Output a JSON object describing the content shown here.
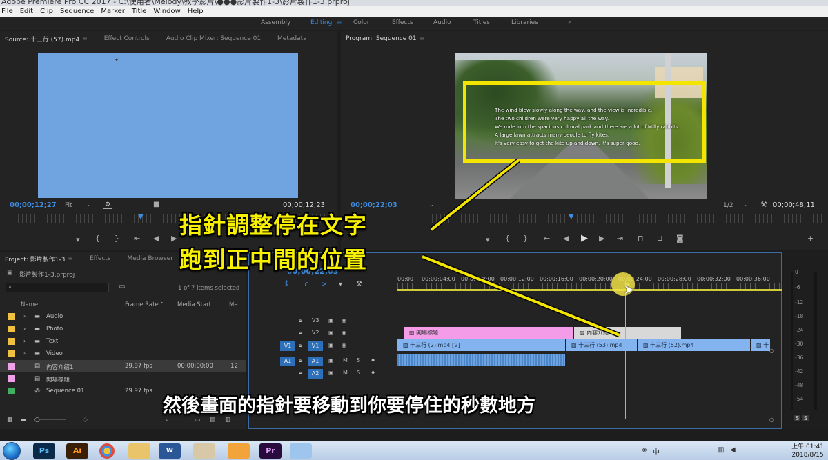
{
  "window": {
    "title": "Adobe Premiere Pro CC 2017 - C:\\使用者\\Melody\\教學影片\\●●●影片製作1-3\\影片製作1-3.prproj"
  },
  "menu": [
    "File",
    "Edit",
    "Clip",
    "Sequence",
    "Marker",
    "Title",
    "Window",
    "Help"
  ],
  "workspaces": {
    "items": [
      "Assembly",
      "Editing",
      "Color",
      "Effects",
      "Audio",
      "Titles",
      "Libraries"
    ],
    "active": "Editing",
    "more": "»"
  },
  "source_panel": {
    "tabs": [
      "Source: 十三行 (57).mp4",
      "Effect Controls",
      "Audio Clip Mixer: Sequence 01",
      "Metadata"
    ],
    "timecode": "00;00;12;27",
    "zoom": "Fit",
    "duration": "00;00;12;23"
  },
  "program_panel": {
    "tab": "Program: Sequence 01",
    "timecode": "00;00;22;03",
    "resolution": "1/2",
    "duration": "00;00;48;11",
    "subtitle_lines": [
      "The wind blew slowly along the way, and the view is incredible.",
      "The two children were very happy all the way.",
      "We rode into the spacious cultural park and there are a lot of Milly rabbits.",
      "A large lawn attracts many people to fly kites.",
      "It's very easy to get the kite up and down. It's super good."
    ]
  },
  "project_panel": {
    "tabs": [
      "Project: 影片製作1-3",
      "Effects",
      "Media Browser"
    ],
    "file": "影片製作1-3.prproj",
    "count": "1 of 7 items selected",
    "columns": [
      "Name",
      "Frame Rate",
      "Media Start",
      "Me"
    ],
    "rows": [
      {
        "name": "Audio",
        "color": "#f0c040",
        "rate": "",
        "start": "",
        "extra": ""
      },
      {
        "name": "Photo",
        "color": "#f0c040",
        "rate": "",
        "start": "",
        "extra": ""
      },
      {
        "name": "Text",
        "color": "#f0c040",
        "rate": "",
        "start": "",
        "extra": ""
      },
      {
        "name": "Video",
        "color": "#f0c040",
        "rate": "",
        "start": "",
        "extra": ""
      },
      {
        "name": "內容介紹1",
        "color": "#f0a0e8",
        "rate": "29.97 fps",
        "start": "00;00;00;00",
        "extra": "12"
      },
      {
        "name": "開場標題",
        "color": "#f0a0e8",
        "rate": "",
        "start": "",
        "extra": ""
      },
      {
        "name": "Sequence 01",
        "color": "#40b060",
        "rate": "29.97 fps",
        "start": "",
        "extra": ""
      }
    ]
  },
  "timeline": {
    "timecode": "00;00;22;03",
    "times": [
      "00;00",
      "00;00;04;00",
      "00;00;08;00",
      "00;00;12;00",
      "00;00;16;00",
      "00;00;20;00",
      "00;00;24;00",
      "00;00;28;00",
      "00;00;32;00",
      "00;00;36;00"
    ],
    "tracks": {
      "v3": "V3",
      "v2": "V2",
      "v1": "V1",
      "a1": "A1",
      "a2": "A2",
      "m": "M",
      "s": "S"
    },
    "clips": {
      "title1": "開場標題",
      "title2": "內容介紹",
      "video1": "十三行 (2).mp4 [V]",
      "video2": "十三行 (53).mp4",
      "video3": "十三行 (52).mp4",
      "video4": "十"
    }
  },
  "meters": {
    "scale": [
      "0",
      "-6",
      "-12",
      "-18",
      "-24",
      "-30",
      "-36",
      "-42",
      "-48",
      "-54"
    ],
    "solo": [
      "S",
      "S"
    ]
  },
  "annotation": {
    "line1": "指針調整停在文字",
    "line2": "跑到正中間的位置",
    "caption": "然後畫面的指針要移動到你要停住的秒數地方"
  },
  "taskbar": {
    "apps": [
      "Ps",
      "Ai",
      "Pr"
    ],
    "lang": "中",
    "time": "上午 01:41",
    "date": "2018/8/15",
    "colors": {
      "ps": "#0b2a4a",
      "ai": "#3a1f06",
      "pr": "#2a0b3d"
    }
  }
}
